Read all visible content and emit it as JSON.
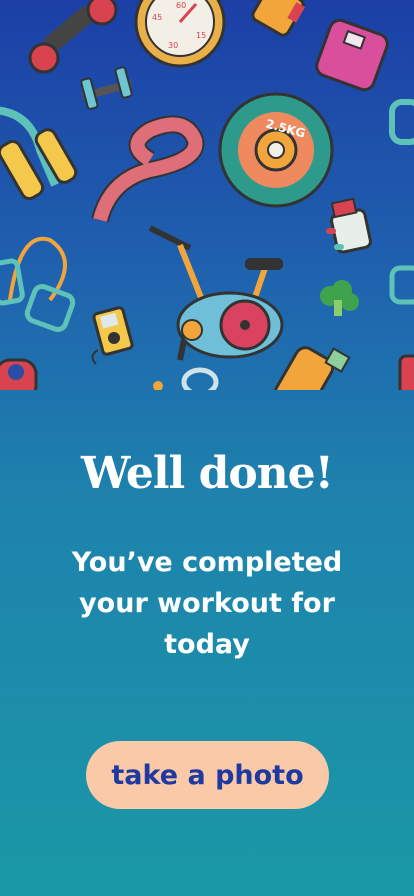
{
  "hero": {
    "plate_label": "2.5KG",
    "stopwatch_ticks": [
      "60",
      "45",
      "15",
      "30"
    ]
  },
  "heading": "Well done!",
  "message": "You’ve completed your workout for today",
  "primary_button": {
    "label": "take a photo"
  },
  "colors": {
    "background_top": "#1c3fa6",
    "background_bottom": "#1a98a6",
    "button_bg": "#fac9a8",
    "button_text": "#1e3aa0"
  },
  "icons": [
    "dumbbell-icon",
    "stopwatch-icon",
    "bottle-icon",
    "scale-icon",
    "hand-grip-icon",
    "measuring-tape-icon",
    "weight-plate-icon",
    "supplement-bottle-icon",
    "jump-rope-icon",
    "exercise-bike-icon",
    "broccoli-icon",
    "music-player-icon",
    "kettlebell-icon",
    "water-bottle-icon"
  ]
}
